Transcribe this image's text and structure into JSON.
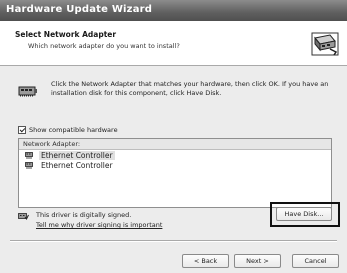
{
  "window": {
    "title": "Hardware Update Wizard"
  },
  "header": {
    "title": "Select Network Adapter",
    "subtitle": "Which network adapter do you want to install?"
  },
  "instructions": "Click the Network Adapter that matches your hardware, then click OK. If you have an installation disk for this component, click Have Disk.",
  "compatible": {
    "label": "Show compatible hardware",
    "checked": true
  },
  "adapter_list": {
    "header": "Network Adapter:",
    "items": [
      {
        "label": "Ethernet Controller",
        "selected": true
      },
      {
        "label": "Ethernet Controller",
        "selected": false
      }
    ]
  },
  "driver": {
    "signed_text": "This driver is digitally signed.",
    "link_text": "Tell me why driver signing is important"
  },
  "buttons": {
    "have_disk": "Have Disk...",
    "back": "< Back",
    "next": "Next >",
    "cancel": "Cancel"
  },
  "icons": {
    "header_icon": "network-card-wizard-icon",
    "info_icon": "network-adapter-icon",
    "item_icon": "network-adapter-icon",
    "signed_icon": "signed-driver-icon"
  }
}
